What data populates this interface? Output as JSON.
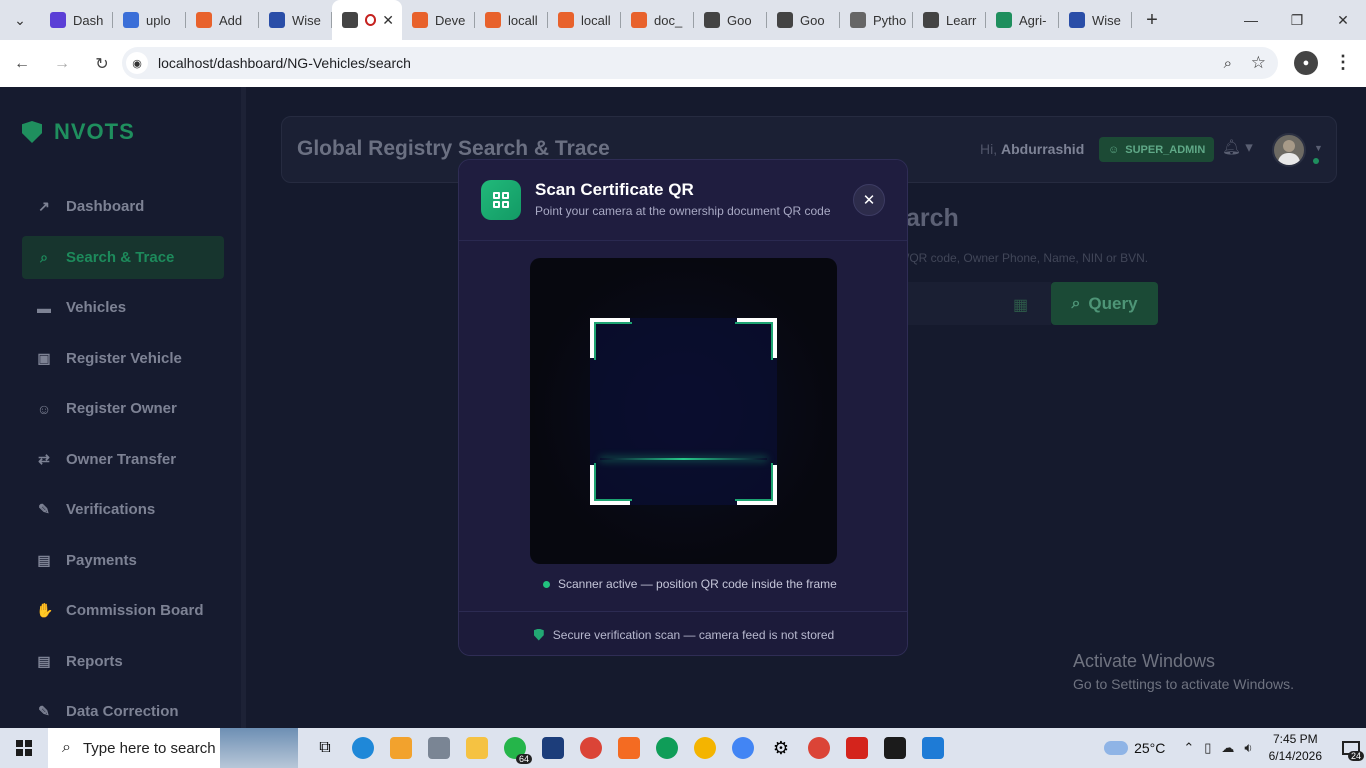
{
  "browser": {
    "tabs": [
      {
        "label": "Dash",
        "color": "#5b3fd6"
      },
      {
        "label": "uplo",
        "color": "#3b6fd8"
      },
      {
        "label": "Add",
        "color": "#e8622c"
      },
      {
        "label": "Wise",
        "color": "#2a4ea8"
      },
      {
        "label": "",
        "color": "#444444",
        "active": true
      },
      {
        "label": "Deve",
        "color": "#e8622c"
      },
      {
        "label": "locall",
        "color": "#e8622c"
      },
      {
        "label": "locall",
        "color": "#e8622c"
      },
      {
        "label": "doc_",
        "color": "#e8622c"
      },
      {
        "label": "Goo",
        "color": "#444444"
      },
      {
        "label": "Goo",
        "color": "#444444"
      },
      {
        "label": "Pytho",
        "color": "#666666"
      },
      {
        "label": "Learr",
        "color": "#444444"
      },
      {
        "label": "Agri-",
        "color": "#1f8f5e"
      },
      {
        "label": "Wise",
        "color": "#2a4ea8"
      }
    ],
    "url": "localhost/dashboard/NG-Vehicles/search"
  },
  "app": {
    "brand": "NVOTS",
    "menu": [
      {
        "label": "Dashboard",
        "icon": "chart-line-icon",
        "glyph": "↗"
      },
      {
        "label": "Search & Trace",
        "icon": "search-icon",
        "glyph": "⌕",
        "active": true
      },
      {
        "label": "Vehicles",
        "icon": "car-icon",
        "glyph": "▬"
      },
      {
        "label": "Register Vehicle",
        "icon": "car-front-icon",
        "glyph": "▣"
      },
      {
        "label": "Register Owner",
        "icon": "user-plus-icon",
        "glyph": "☺"
      },
      {
        "label": "Owner Transfer",
        "icon": "exchange-icon",
        "glyph": "⇄"
      },
      {
        "label": "Verifications",
        "icon": "file-check-icon",
        "glyph": "✎"
      },
      {
        "label": "Payments",
        "icon": "receipt-icon",
        "glyph": "▤"
      },
      {
        "label": "Commission Board",
        "icon": "hand-coin-icon",
        "glyph": "✋"
      },
      {
        "label": "Reports",
        "icon": "file-icon",
        "glyph": "▤"
      },
      {
        "label": "Data Correction",
        "icon": "edit-file-icon",
        "glyph": "✎"
      }
    ],
    "page_title": "Global Registry Search & Trace",
    "greeting_prefix": "Hi,",
    "user_name": "Abdurrashid",
    "role": "SUPER_ADMIN",
    "bg_title": "arch",
    "bg_subtitle": "/QR code, Owner Phone, Name, NIN or BVN.",
    "query_label": "Query"
  },
  "modal": {
    "title": "Scan Certificate QR",
    "subtitle": "Point your camera at the ownership document QR code",
    "status": "Scanner active — position QR code inside the frame",
    "footer": "Secure verification scan — camera feed is not stored"
  },
  "watermark": {
    "line1": "Activate Windows",
    "line2": "Go to Settings to activate Windows."
  },
  "taskbar": {
    "search_placeholder": "Type here to search",
    "whatsapp_badge": "64",
    "temperature": "25°C",
    "time": "7:45 PM",
    "date": "6/14/2026",
    "notifications": "24"
  }
}
